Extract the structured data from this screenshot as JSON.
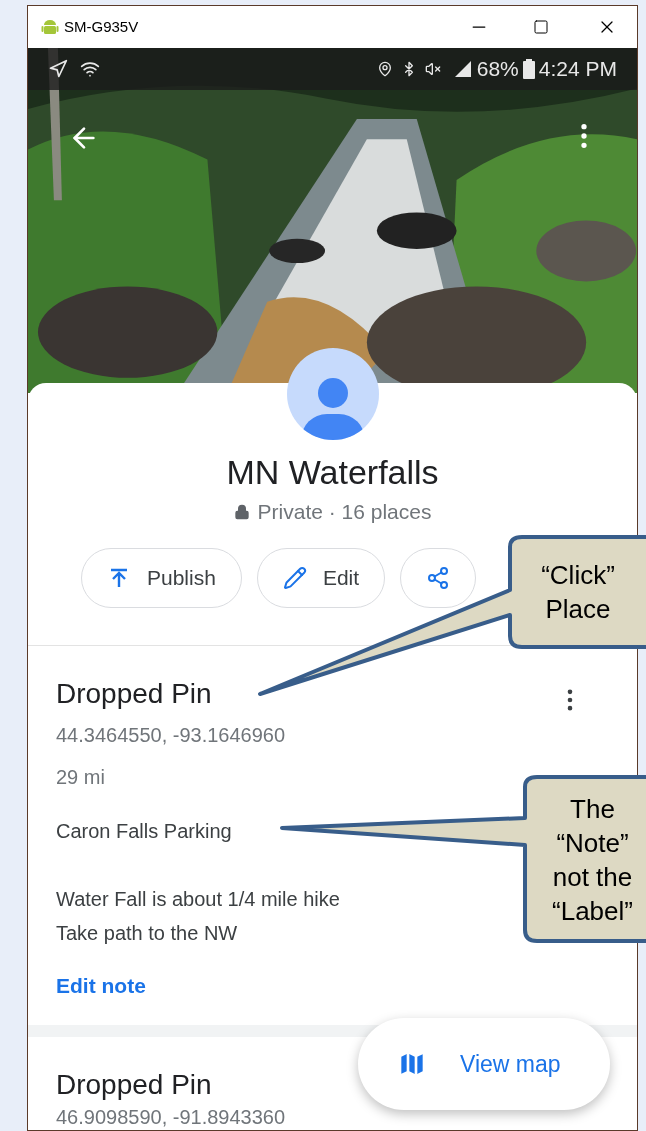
{
  "window": {
    "title": "SM-G935V"
  },
  "status_bar": {
    "battery": "68%",
    "time": "4:24 PM"
  },
  "list": {
    "title": "MN Waterfalls",
    "privacy": "Private · 16 places"
  },
  "actions": [
    {
      "kind": "publish",
      "label": "Publish"
    },
    {
      "kind": "edit",
      "label": "Edit"
    },
    {
      "kind": "share"
    }
  ],
  "places": [
    {
      "title": "Dropped Pin",
      "coords": "44.3464550, -93.1646960",
      "distance": "29 mi",
      "label": "Caron Falls Parking",
      "note": [
        "Water Fall is about 1/4 mile hike",
        "Take path to the NW"
      ],
      "edit_note": "Edit note"
    },
    {
      "title": "Dropped Pin",
      "coords": "46.9098590, -91.8943360"
    }
  ],
  "fab": {
    "label": "View map"
  },
  "callouts": [
    {
      "lines": [
        "“Click”",
        "Place"
      ]
    },
    {
      "lines": [
        "The",
        "“Note”",
        "not the",
        "“Label”"
      ]
    }
  ]
}
